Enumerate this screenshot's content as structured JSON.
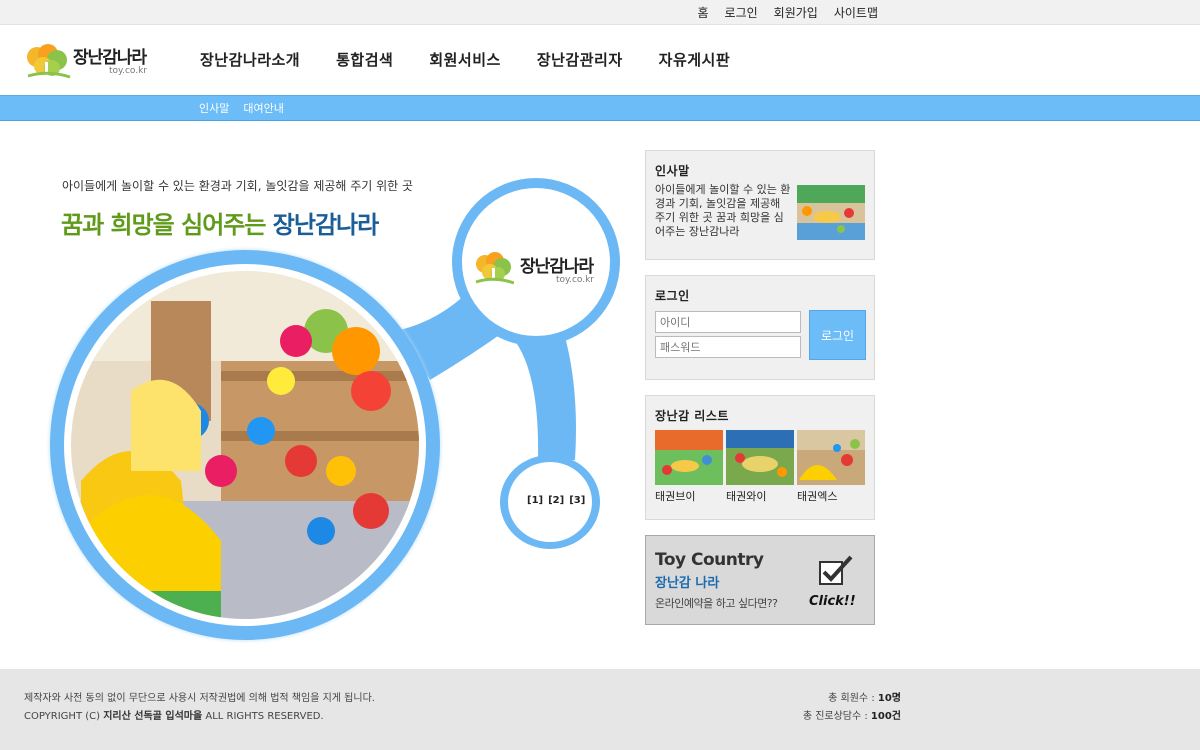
{
  "utility_links": [
    "홈",
    "로그인",
    "회원가입",
    "사이트맵"
  ],
  "logo": {
    "word": "장난감나라",
    "domain": "toy.co.kr"
  },
  "gnb": [
    "장난감나라소개",
    "통합검색",
    "회원서비스",
    "장난감관리자",
    "자유게시판"
  ],
  "subnav": [
    "인사말",
    "대여안내"
  ],
  "hero": {
    "subtitle": "아이들에게 놀이할 수 있는 환경과 기회, 놀잇감을 제공해 주기 위한 곳",
    "title_green": "꿈과 희망을 심어주는 ",
    "title_blue": "장난감나라",
    "pager": [
      "[1]",
      "[2]",
      "[3]"
    ]
  },
  "greeting": {
    "title": "인사말",
    "text": "아이들에게 놀이할 수 있는 환경과 기회, 놀잇감을 제공해 주기 위한 곳 꿈과 희망을 심어주는 장난감나라"
  },
  "login": {
    "title": "로그인",
    "id_placeholder": "아이디",
    "pw_placeholder": "패스워드",
    "button": "로그인"
  },
  "toy_list": {
    "title": "장난감 리스트",
    "items": [
      "태권브이",
      "태권와이",
      "태권엑스"
    ]
  },
  "banner": {
    "line1": "Toy Country",
    "line2": "장난감 나라",
    "line3": "온라인예약을 하고 싶다면??",
    "click": "Click!!"
  },
  "footer": {
    "notice": "제작자와 사전 동의 없이 무단으로 사용시 저작권법에 의해 법적 책임을 지게 됩니다.",
    "copy_prefix": "COPYRIGHT (C) ",
    "copy_name": "지리산 선독골 입석마을",
    "copy_suffix": " ALL RIGHTS RESERVED.",
    "members_label": "총 회원수 : ",
    "members_value": "10명",
    "consult_label": "총 진로상담수 : ",
    "consult_value": "100건"
  },
  "colors": {
    "accent_blue": "#6cbcf8",
    "title_green": "#5f9a1a",
    "title_blue": "#1b5d96"
  }
}
